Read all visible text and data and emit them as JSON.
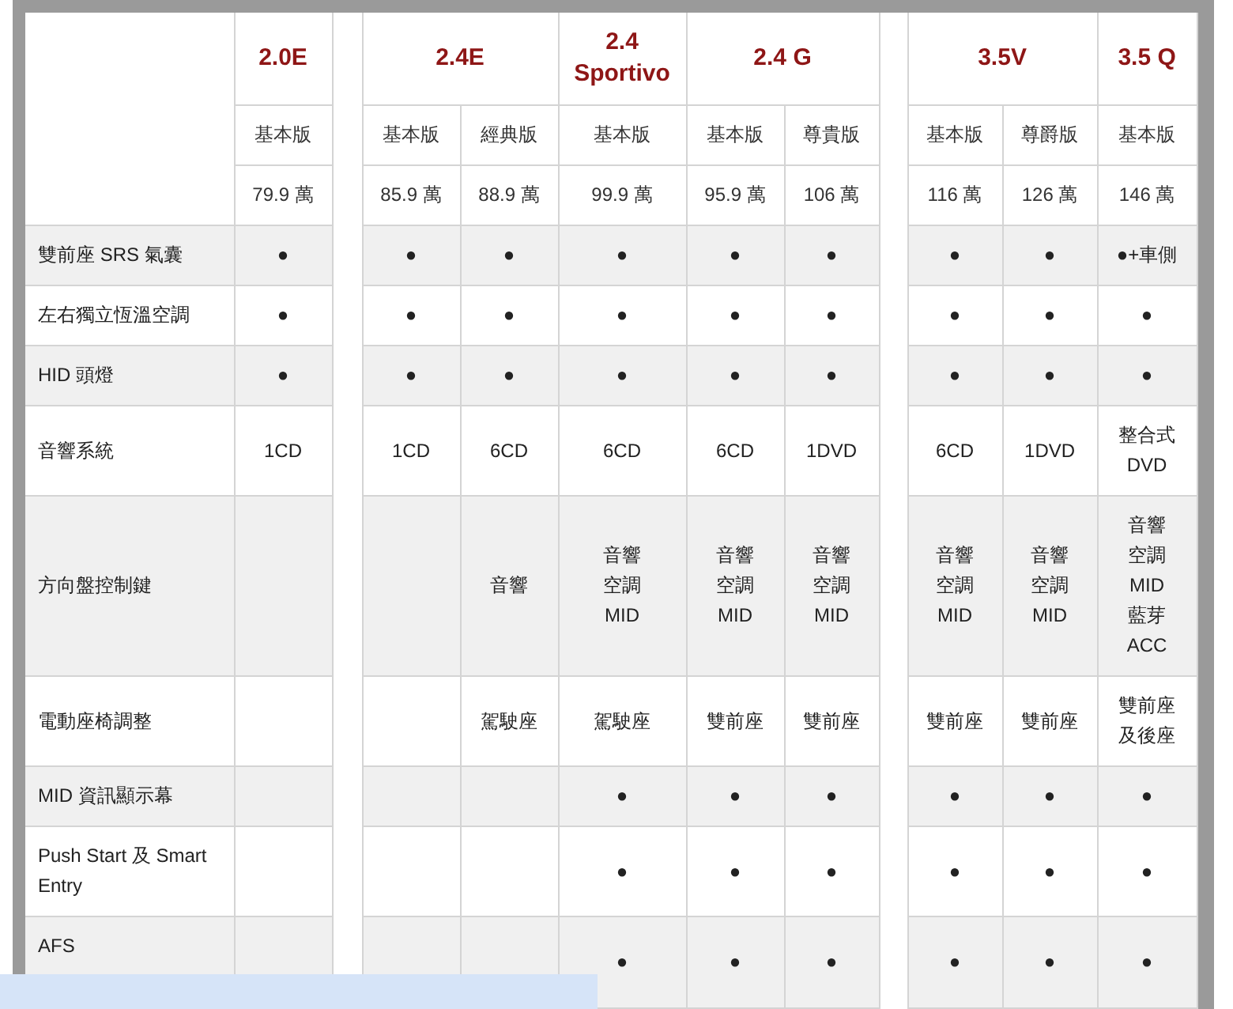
{
  "groups": [
    {
      "models": [
        {
          "name": "2.0E",
          "trims": [
            {
              "label": "基本版",
              "price": "79.9 萬"
            }
          ]
        }
      ]
    },
    {
      "models": [
        {
          "name": "2.4E",
          "trims": [
            {
              "label": "基本版",
              "price": "85.9 萬"
            },
            {
              "label": "經典版",
              "price": "88.9 萬"
            }
          ]
        },
        {
          "name": "2.4\nSportivo",
          "trims": [
            {
              "label": "基本版",
              "price": "99.9 萬"
            }
          ]
        },
        {
          "name": "2.4 G",
          "trims": [
            {
              "label": "基本版",
              "price": "95.9 萬"
            },
            {
              "label": "尊貴版",
              "price": "106 萬"
            }
          ]
        }
      ]
    },
    {
      "models": [
        {
          "name": "3.5V",
          "trims": [
            {
              "label": "基本版",
              "price": "116 萬"
            },
            {
              "label": "尊爵版",
              "price": "126 萬"
            }
          ]
        },
        {
          "name": "3.5 Q",
          "trims": [
            {
              "label": "基本版",
              "price": "146 萬"
            }
          ]
        }
      ]
    }
  ],
  "rows": [
    {
      "feature": "雙前座 SRS 氣囊",
      "cells": [
        "●",
        "●",
        "●",
        "●",
        "●",
        "●",
        "●",
        "●",
        "●+車側"
      ]
    },
    {
      "feature": "左右獨立恆溫空調",
      "cells": [
        "●",
        "●",
        "●",
        "●",
        "●",
        "●",
        "●",
        "●",
        "●"
      ]
    },
    {
      "feature": "HID 頭燈",
      "cells": [
        "●",
        "●",
        "●",
        "●",
        "●",
        "●",
        "●",
        "●",
        "●"
      ]
    },
    {
      "feature": "音響系統",
      "cells": [
        "1CD",
        "1CD",
        "6CD",
        "6CD",
        "6CD",
        "1DVD",
        "6CD",
        "1DVD",
        [
          "整合式",
          "DVD"
        ]
      ]
    },
    {
      "feature": "方向盤控制鍵",
      "cells": [
        null,
        null,
        "音響",
        [
          "音響",
          "空調",
          "MID"
        ],
        [
          "音響",
          "空調",
          "MID"
        ],
        [
          "音響",
          "空調",
          "MID"
        ],
        [
          "音響",
          "空調",
          "MID"
        ],
        [
          "音響",
          "空調",
          "MID"
        ],
        [
          "音響",
          "空調",
          "MID",
          "藍芽",
          "ACC"
        ]
      ]
    },
    {
      "feature": "電動座椅調整",
      "cells": [
        null,
        null,
        "駕駛座",
        "駕駛座",
        "雙前座",
        "雙前座",
        "雙前座",
        "雙前座",
        [
          "雙前座",
          "及後座"
        ]
      ]
    },
    {
      "feature": "MID 資訊顯示幕",
      "cells": [
        null,
        null,
        null,
        "●",
        "●",
        "●",
        "●",
        "●",
        "●"
      ]
    },
    {
      "feature": "Push Start 及 Smart Entry",
      "cells": [
        null,
        null,
        null,
        "●",
        "●",
        "●",
        "●",
        "●",
        "●"
      ]
    },
    {
      "feature": "AFS",
      "cells": [
        null,
        null,
        null,
        "●",
        "●",
        "●",
        "●",
        "●",
        "●"
      ]
    }
  ]
}
